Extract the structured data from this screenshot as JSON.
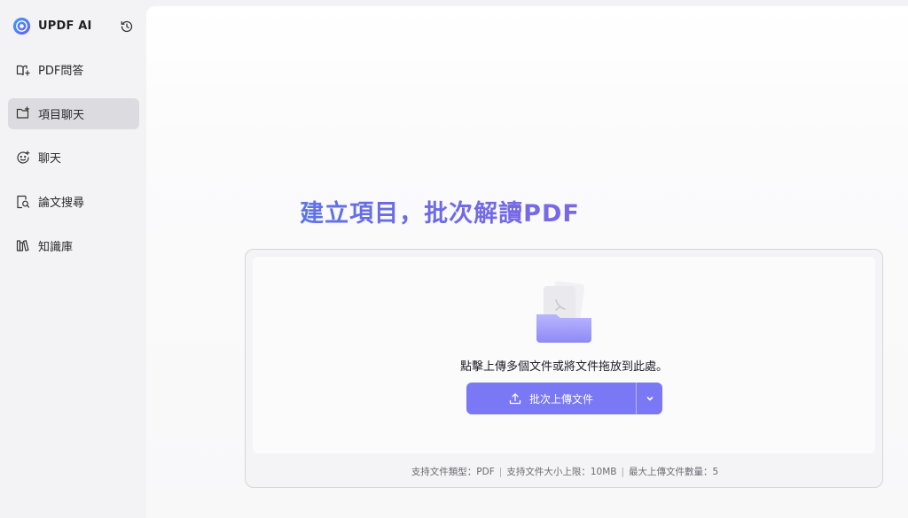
{
  "app": {
    "name": "UPDF AI"
  },
  "sidebar": {
    "items": [
      {
        "label": "PDF問答",
        "icon": "book-icon"
      },
      {
        "label": "項目聊天",
        "icon": "folder-add-icon",
        "active": true
      },
      {
        "label": "聊天",
        "icon": "chat-smile-icon"
      },
      {
        "label": "論文搜尋",
        "icon": "doc-search-icon"
      },
      {
        "label": "知識庫",
        "icon": "library-icon"
      }
    ]
  },
  "main": {
    "headline": "建立項目，批次解讀PDF",
    "drop_text": "點擊上傳多個文件或將文件拖放到此處。",
    "upload_button": "批次上傳文件",
    "limits": {
      "types": "支持文件類型：PDF",
      "size": "支持文件大小上限：10MB",
      "count": "最大上傳文件數量：5",
      "separator": "|"
    }
  },
  "colors": {
    "accent": "#7b78f5",
    "headline_start": "#4a82e6",
    "headline_end": "#8a68e8",
    "sidebar_active": "#dcdce0"
  }
}
